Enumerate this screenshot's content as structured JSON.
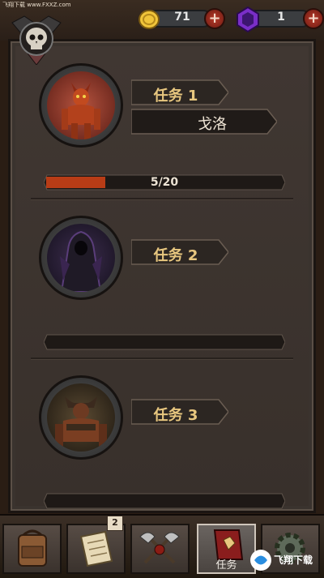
{
  "watermark": "飞翔下载 www.FXXZ.com",
  "currency": {
    "gold": "71",
    "gems": "1",
    "add_label": "+"
  },
  "quests": [
    {
      "label": "任务 1",
      "name": "戈洛",
      "progress": "5/20",
      "progress_fraction": 0.25
    },
    {
      "label": "任务 2",
      "name": "",
      "progress": "",
      "progress_fraction": 0
    },
    {
      "label": "任务 3",
      "name": "",
      "progress": "",
      "progress_fraction": 0
    }
  ],
  "nav": {
    "items": [
      {
        "icon": "backpack-icon",
        "label": ""
      },
      {
        "icon": "scroll-map-icon",
        "label": "",
        "badge": "2"
      },
      {
        "icon": "crossed-axes-icon",
        "label": ""
      },
      {
        "icon": "quest-book-icon",
        "label": "任务"
      },
      {
        "icon": "gear-icon",
        "label": ""
      }
    ]
  },
  "site_logo_text": "飞翔下载",
  "colors": {
    "accent_gold": "#e8c77f",
    "progress_fill": "#b83c16",
    "panel": "#3a332e"
  }
}
